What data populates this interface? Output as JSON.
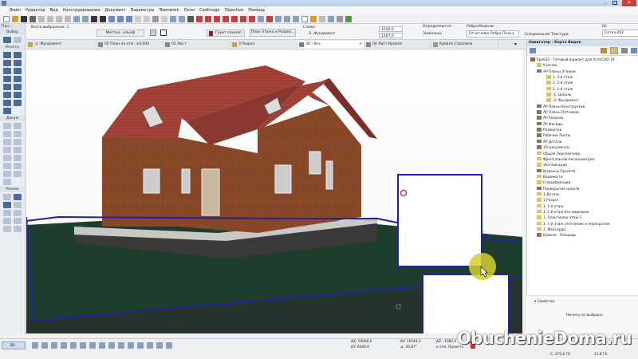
{
  "menu": [
    "Файл",
    "Редактор",
    "Вид",
    "Конструирование",
    "Документ",
    "Параметры",
    "Teamwork",
    "Окно",
    "CadImage",
    "Objective",
    "Помощь"
  ],
  "infobox": {
    "selected": "Всего выбранных: 1",
    "surface": "Местно...ельеф",
    "material": "Грунт (земля)",
    "story_label": "План Этажа и Разрез...",
    "layer_label": "Слоев:",
    "story_value": "-2. Фундамент",
    "dim1": "1500,0",
    "dim2": "1267,0",
    "defined_label": "Определяются:",
    "defined_value": "Заменены",
    "edges_label": "Ребра Модели:",
    "edges_value": "Отчетливо Ребра Польз.",
    "texture_label": "Специальная Текстура",
    "id_label": "ID:",
    "id_value": "Сетка-002"
  },
  "toolbox": {
    "title": "Пан...",
    "select": "Выбор",
    "construct": "Констр",
    "document": "Докум",
    "misc": "Разное"
  },
  "tabs": [
    "-2. Фундамент",
    "05 План на отм. ±0.000",
    "03 Лист",
    "3 Разрез",
    "3D / Все",
    "04 Лист Кровля",
    "Кровля Стропила"
  ],
  "navigator": {
    "title": "Навигатор - Карта Видов",
    "tree": [
      {
        "label": "Урок23 - Готовый вариант для ArchiCAD 19",
        "level": 0,
        "icon": "project"
      },
      {
        "label": "Участок",
        "level": 1,
        "icon": "folder"
      },
      {
        "label": "АР Планы Этажей",
        "level": 1,
        "icon": "view"
      },
      {
        "label": "3. 3-й этаж",
        "level": 2,
        "icon": "folder"
      },
      {
        "label": "2. 2-й этаж",
        "level": 2,
        "icon": "folder"
      },
      {
        "label": "1. 1-й этаж",
        "level": 2,
        "icon": "folder"
      },
      {
        "label": "-1. Цоколь",
        "level": 2,
        "icon": "folder"
      },
      {
        "label": "-2. Фундамент",
        "level": 2,
        "icon": "folder"
      },
      {
        "label": "АР Планы Конструктив",
        "level": 1,
        "icon": "view"
      },
      {
        "label": "АР Планы Потолков",
        "level": 1,
        "icon": "view"
      },
      {
        "label": "АР Разрезы",
        "level": 1,
        "icon": "view"
      },
      {
        "label": "АР Фасады",
        "level": 1,
        "icon": "view"
      },
      {
        "label": "Развертки",
        "level": 1,
        "icon": "view"
      },
      {
        "label": "Рабочие Листы",
        "level": 1,
        "icon": "view"
      },
      {
        "label": "АР Детали",
        "level": 1,
        "icon": "view"
      },
      {
        "label": "3D-документы",
        "level": 1,
        "icon": "view"
      },
      {
        "label": "Общая Перспектива",
        "level": 1,
        "icon": "folder"
      },
      {
        "label": "Фронтальная Аксонометрия",
        "level": 1,
        "icon": "folder"
      },
      {
        "label": "Экспликации",
        "level": 1,
        "icon": "folder"
      },
      {
        "label": "Индексы Проекта",
        "level": 1,
        "icon": "view"
      },
      {
        "label": "Ведомости",
        "level": 1,
        "icon": "folder"
      },
      {
        "label": "Спецификации",
        "level": 1,
        "icon": "folder"
      },
      {
        "label": "Перекрытие цоколя",
        "level": 1,
        "icon": "view"
      },
      {
        "label": "1 Деталь",
        "level": 1,
        "icon": "folder"
      },
      {
        "label": "1 Разрез",
        "level": 1,
        "icon": "folder"
      },
      {
        "label": "1. 1-й этаж",
        "level": 1,
        "icon": "folder"
      },
      {
        "label": "1. 1-й этаж без маркеров",
        "level": 1,
        "icon": "folder"
      },
      {
        "label": "1. План балок этаж 1",
        "level": 1,
        "icon": "folder"
      },
      {
        "label": "1. 1-й этаж утепление и перекрытие",
        "level": 1,
        "icon": "folder"
      },
      {
        "label": "2. Мансарда",
        "level": 1,
        "icon": "folder"
      },
      {
        "label": "Кровля - Площадь",
        "level": 1,
        "icon": "view"
      }
    ]
  },
  "properties": {
    "title": "Свойства",
    "empty": "Ничего не выбрано"
  },
  "bottom": {
    "view_mode": "3D-окно",
    "dx": "ΔX: 10006,0",
    "dy": "ΔY: 9280,9",
    "dr": "ΔY: 10544,3",
    "angle": "∡: 30,87°",
    "dz": "ΔZ: -1082,0",
    "ref": "к отм. Проекта"
  },
  "status": {
    "disk": "C: 275,8 ГБ",
    "ram": "11,8 ГБ"
  },
  "watermark": "ObuchenieDoma.ru"
}
